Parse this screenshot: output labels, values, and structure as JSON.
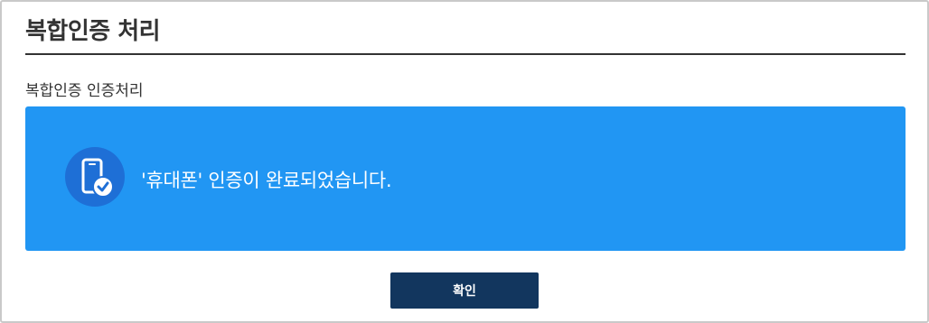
{
  "page": {
    "title": "복합인증 처리"
  },
  "section": {
    "label": "복합인증 인증처리"
  },
  "result": {
    "icon": "phone-verified-icon",
    "message": "'휴대폰' 인증이 완료되었습니다.",
    "panel_color": "#2196f3",
    "icon_circle_color": "#1e6fd6"
  },
  "actions": {
    "confirm_label": "확인",
    "confirm_color": "#12365e"
  }
}
